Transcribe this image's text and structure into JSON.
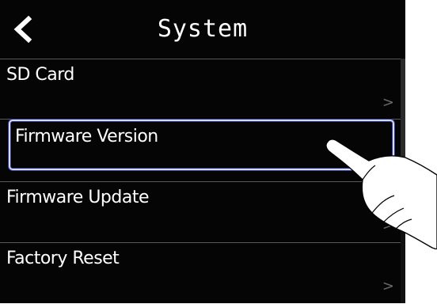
{
  "header": {
    "title": "System",
    "back_icon": "chevron-left-icon"
  },
  "menu": {
    "items": [
      {
        "label": "SD Card",
        "chevron": ">"
      },
      {
        "label": "Firmware Version",
        "chevron": ">",
        "selected": true
      },
      {
        "label": "Firmware Update",
        "chevron": ">"
      },
      {
        "label": "Factory Reset",
        "chevron": ">"
      }
    ]
  },
  "overlay": {
    "gesture_icon": "pointing-hand-icon"
  },
  "colors": {
    "background": "#050505",
    "text": "#ffffff",
    "divider": "#5a5a5a",
    "selection_border": "#d8dcf5",
    "selection_glow": "#2f3a9a"
  }
}
